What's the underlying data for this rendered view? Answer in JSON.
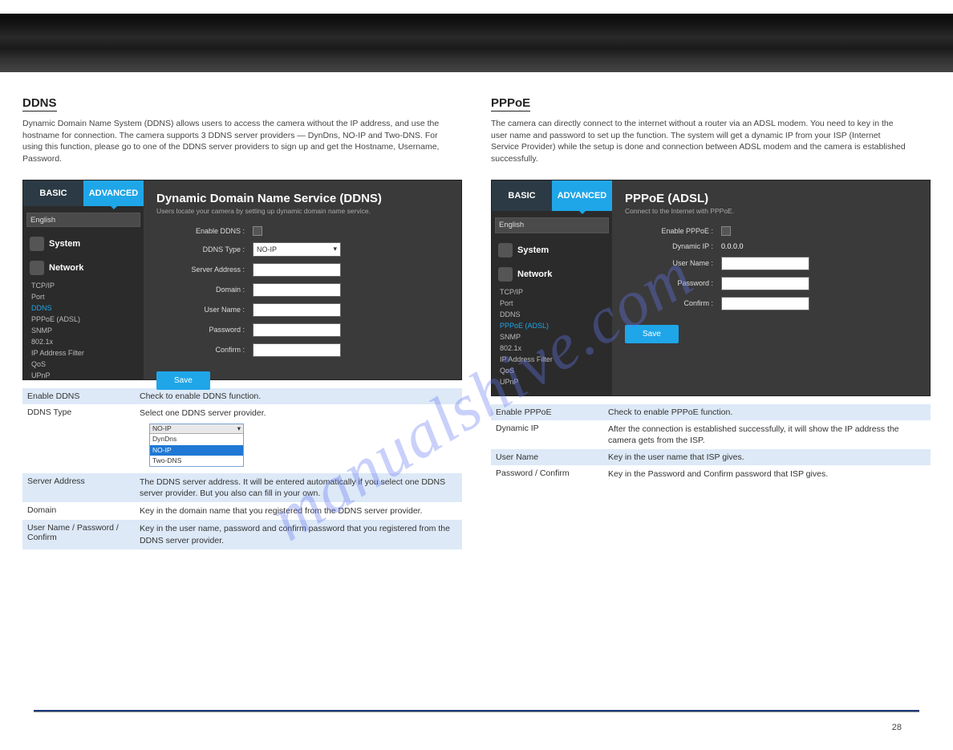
{
  "left": {
    "heading": "DDNS",
    "intro": "Dynamic Domain Name System (DDNS) allows users to access the camera without the IP address, and use the hostname for connection. The camera supports 3 DDNS server providers — DynDns, NO-IP and Two-DNS. For using this function, please go to one of the DDNS server providers to sign up and get the Hostname, Username, Password.",
    "ui": {
      "tabs": {
        "basic": "BASIC",
        "advanced": "ADVANCED"
      },
      "lang": "English",
      "side_system": "System",
      "side_network": "Network",
      "side_items": [
        "TCP/IP",
        "Port",
        "DDNS",
        "PPPoE (ADSL)",
        "SNMP",
        "802.1x",
        "IP Address Filter",
        "QoS",
        "UPnP"
      ],
      "title": "Dynamic Domain Name Service (DDNS)",
      "subtitle": "Users locate your camera by setting up dynamic domain name service.",
      "fields": {
        "enable": "Enable DDNS :",
        "type": "DDNS Type :",
        "type_value": "NO-IP",
        "server": "Server Address :",
        "domain": "Domain :",
        "user": "User Name :",
        "pass": "Password :",
        "confirm": "Confirm :"
      },
      "save": "Save",
      "dd_sample": {
        "head": "NO-IP",
        "rows": [
          "DynDns",
          "NO-IP",
          "Two-DNS"
        ]
      }
    },
    "table": [
      {
        "k": "Enable DDNS",
        "v": "Check to enable DDNS function."
      },
      {
        "k": "DDNS Type",
        "v": "Select one DDNS server provider."
      },
      {
        "k": "",
        "v": ""
      },
      {
        "k": "Server Address",
        "v": "The DDNS server address. It will be entered automatically if you select one DDNS server provider. But you also can fill in your own."
      },
      {
        "k": "Domain",
        "v": "Key in the domain name that you registered from the DDNS server provider."
      },
      {
        "k": "User Name / Password / Confirm",
        "v": "Key in the user name, password and confirm password that you registered from the DDNS server provider."
      }
    ]
  },
  "right": {
    "heading": "PPPoE",
    "intro": "The camera can directly connect to the internet without a router via an ADSL modem. You need to key in the user name and password to set up the function. The system will get a dynamic IP from your ISP (Internet Service Provider) while the setup is done and connection between ADSL modem and the camera is established successfully.",
    "ui": {
      "tabs": {
        "basic": "BASIC",
        "advanced": "ADVANCED"
      },
      "lang": "English",
      "side_system": "System",
      "side_network": "Network",
      "side_items": [
        "TCP/IP",
        "Port",
        "DDNS",
        "PPPoE (ADSL)",
        "SNMP",
        "802.1x",
        "IP Address Filter",
        "QoS",
        "UPnP"
      ],
      "title": "PPPoE (ADSL)",
      "subtitle": "Connect to the Internet with PPPoE.",
      "fields": {
        "enable": "Enable PPPoE :",
        "dynip_label": "Dynamic IP :",
        "dynip_value": "0.0.0.0",
        "user": "User Name :",
        "pass": "Password :",
        "confirm": "Confirm :"
      },
      "save": "Save"
    },
    "table": [
      {
        "k": "Enable PPPoE",
        "v": "Check to enable PPPoE function."
      },
      {
        "k": "Dynamic IP",
        "v": "After the connection is established successfully, it will show the IP address the camera gets from the ISP."
      },
      {
        "k": "User Name",
        "v": "Key in the user name that ISP gives."
      },
      {
        "k": "Password / Confirm",
        "v": "Key in the Password and Confirm password that ISP gives."
      }
    ]
  },
  "page_number": "28",
  "watermark": "manualshive.com"
}
